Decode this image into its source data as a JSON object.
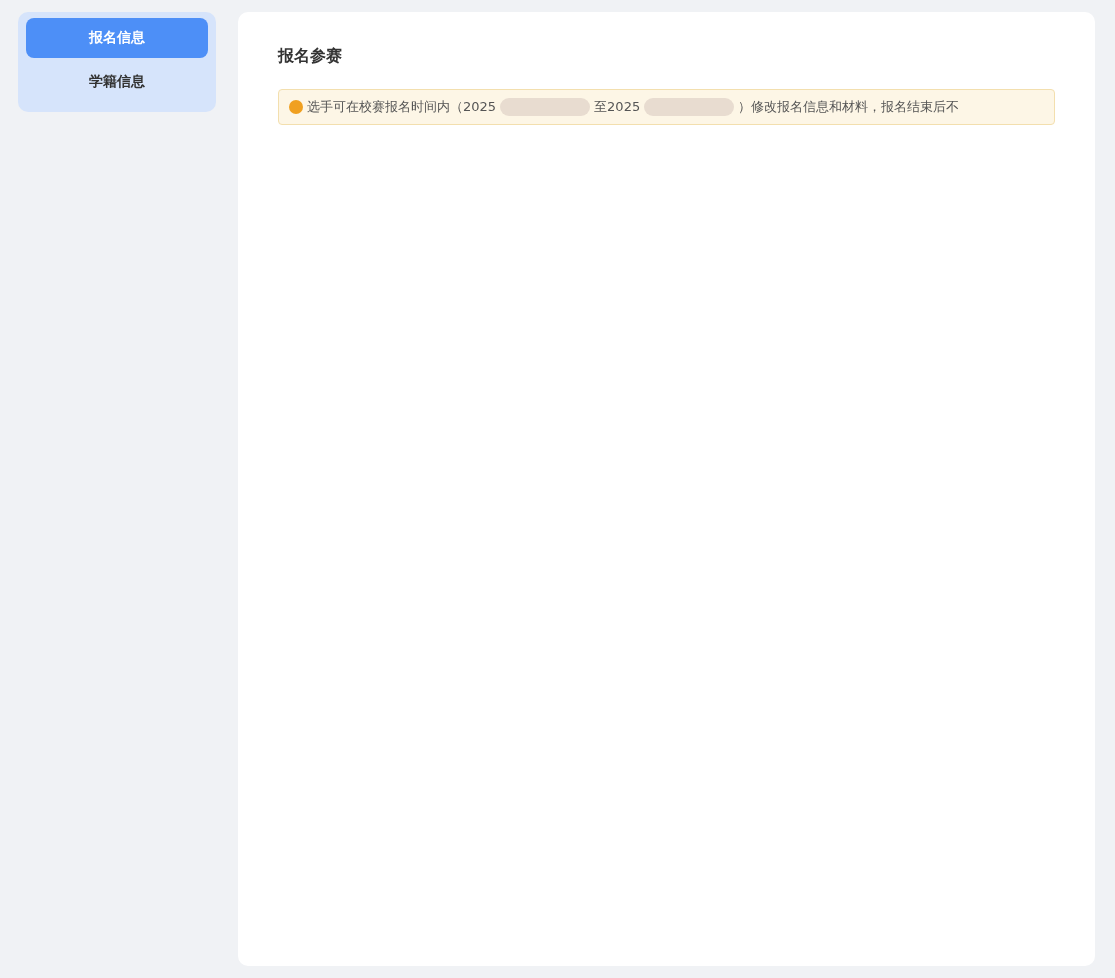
{
  "sidebar": {
    "items": [
      {
        "label": "报名信息",
        "selected": true
      },
      {
        "label": "学籍信息",
        "selected": false
      }
    ]
  },
  "main": {
    "title": "报名参赛",
    "notice": {
      "parts": [
        "选手可在校赛报名时间内（2025",
        "至2025",
        "）修改报名信息和材料，报名结束后不"
      ]
    }
  }
}
